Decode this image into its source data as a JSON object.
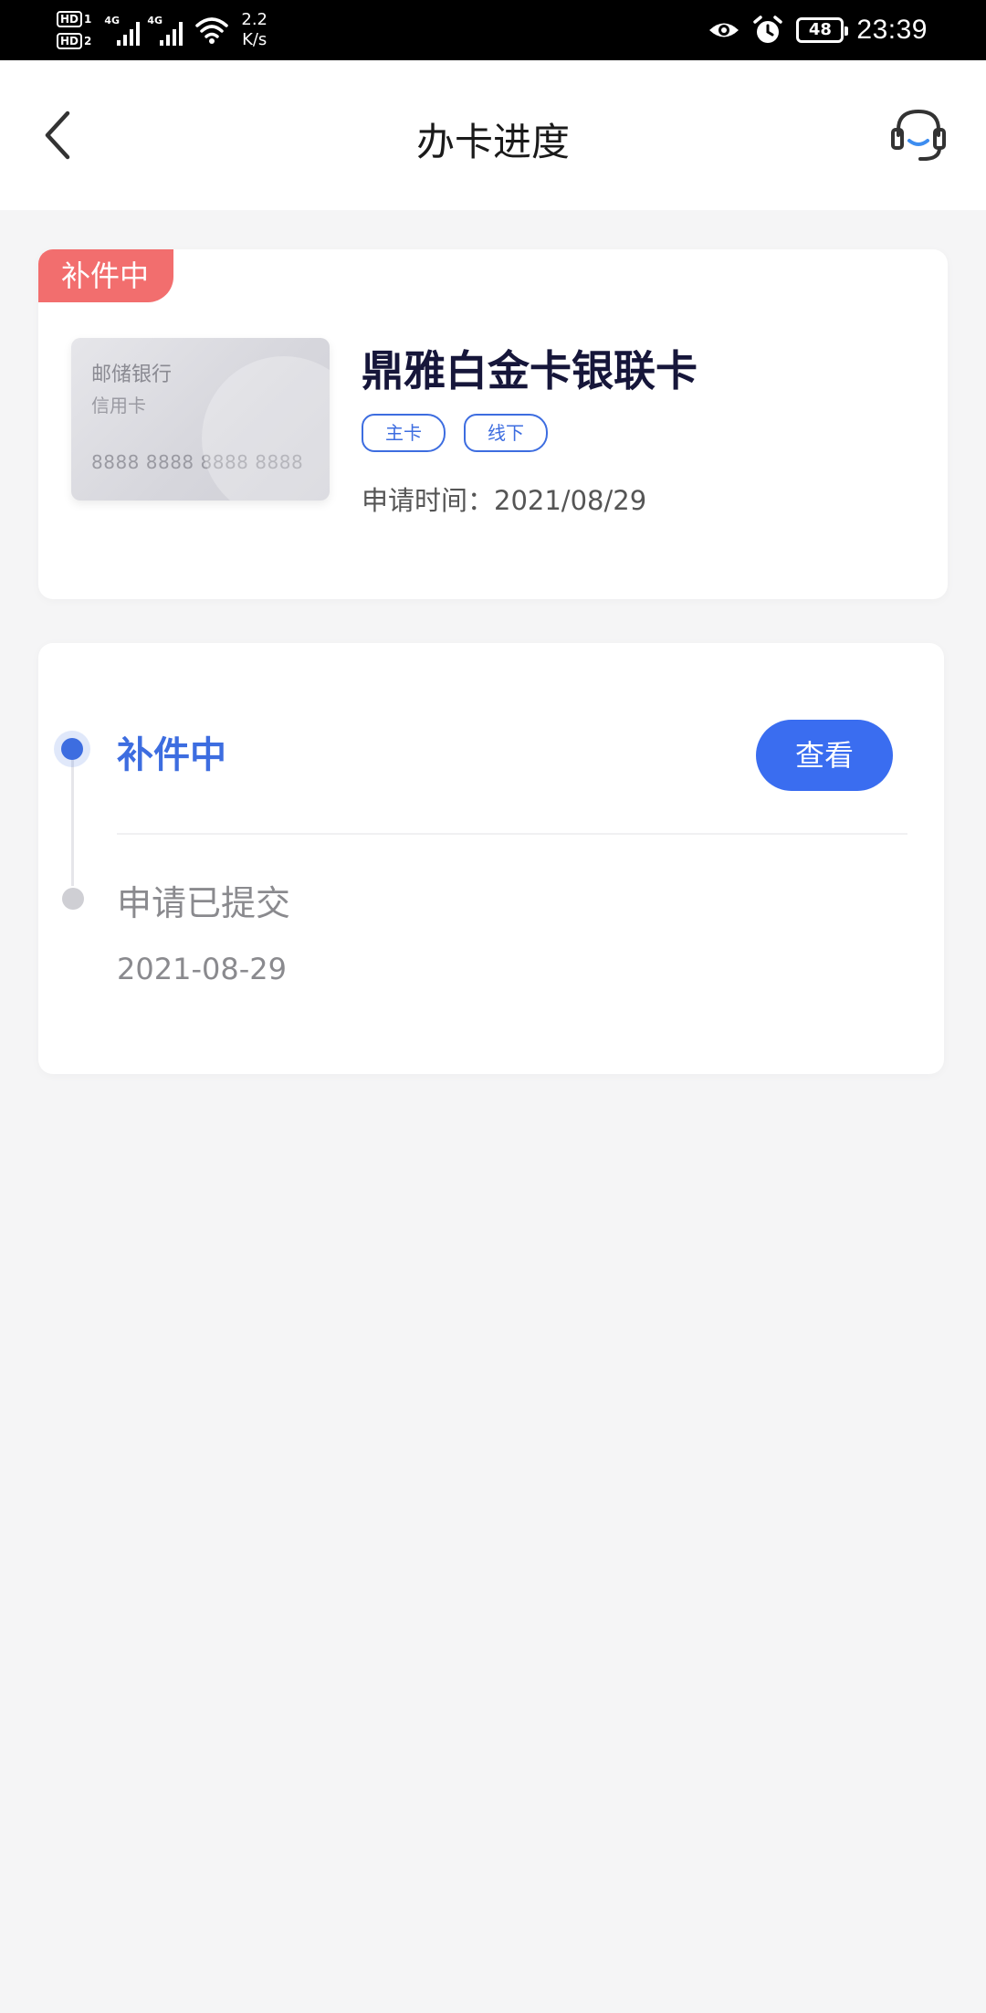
{
  "status_bar": {
    "hd1": "HD",
    "hd1_sim": "1",
    "hd2": "HD",
    "hd2_sim": "2",
    "net1": "4G",
    "net2": "4G",
    "speed_value": "2.2",
    "speed_unit": "K/s",
    "battery": "48",
    "time": "23:39"
  },
  "header": {
    "title": "办卡进度"
  },
  "card": {
    "status_tag": "补件中",
    "image": {
      "bank": "邮储银行",
      "type": "信用卡",
      "number": "8888 8888 8888 8888"
    },
    "name": "鼎雅白金卡银联卡",
    "chips": [
      "主卡",
      "线下"
    ],
    "apply_time": "申请时间：2021/08/29"
  },
  "progress": {
    "steps": [
      {
        "label": "补件中",
        "button_label": "查看"
      },
      {
        "label": "申请已提交",
        "date": "2021-08-29"
      }
    ]
  },
  "icons": {
    "back": "chevron-left-icon",
    "service": "headset-icon",
    "eye": "eye-icon",
    "alarm": "alarm-icon",
    "wifi": "wifi-icon"
  },
  "colors": {
    "accent": "#3d6de0",
    "button": "#3a6df0",
    "status_tag": "#f26e6e",
    "card_name": "#16163a"
  }
}
